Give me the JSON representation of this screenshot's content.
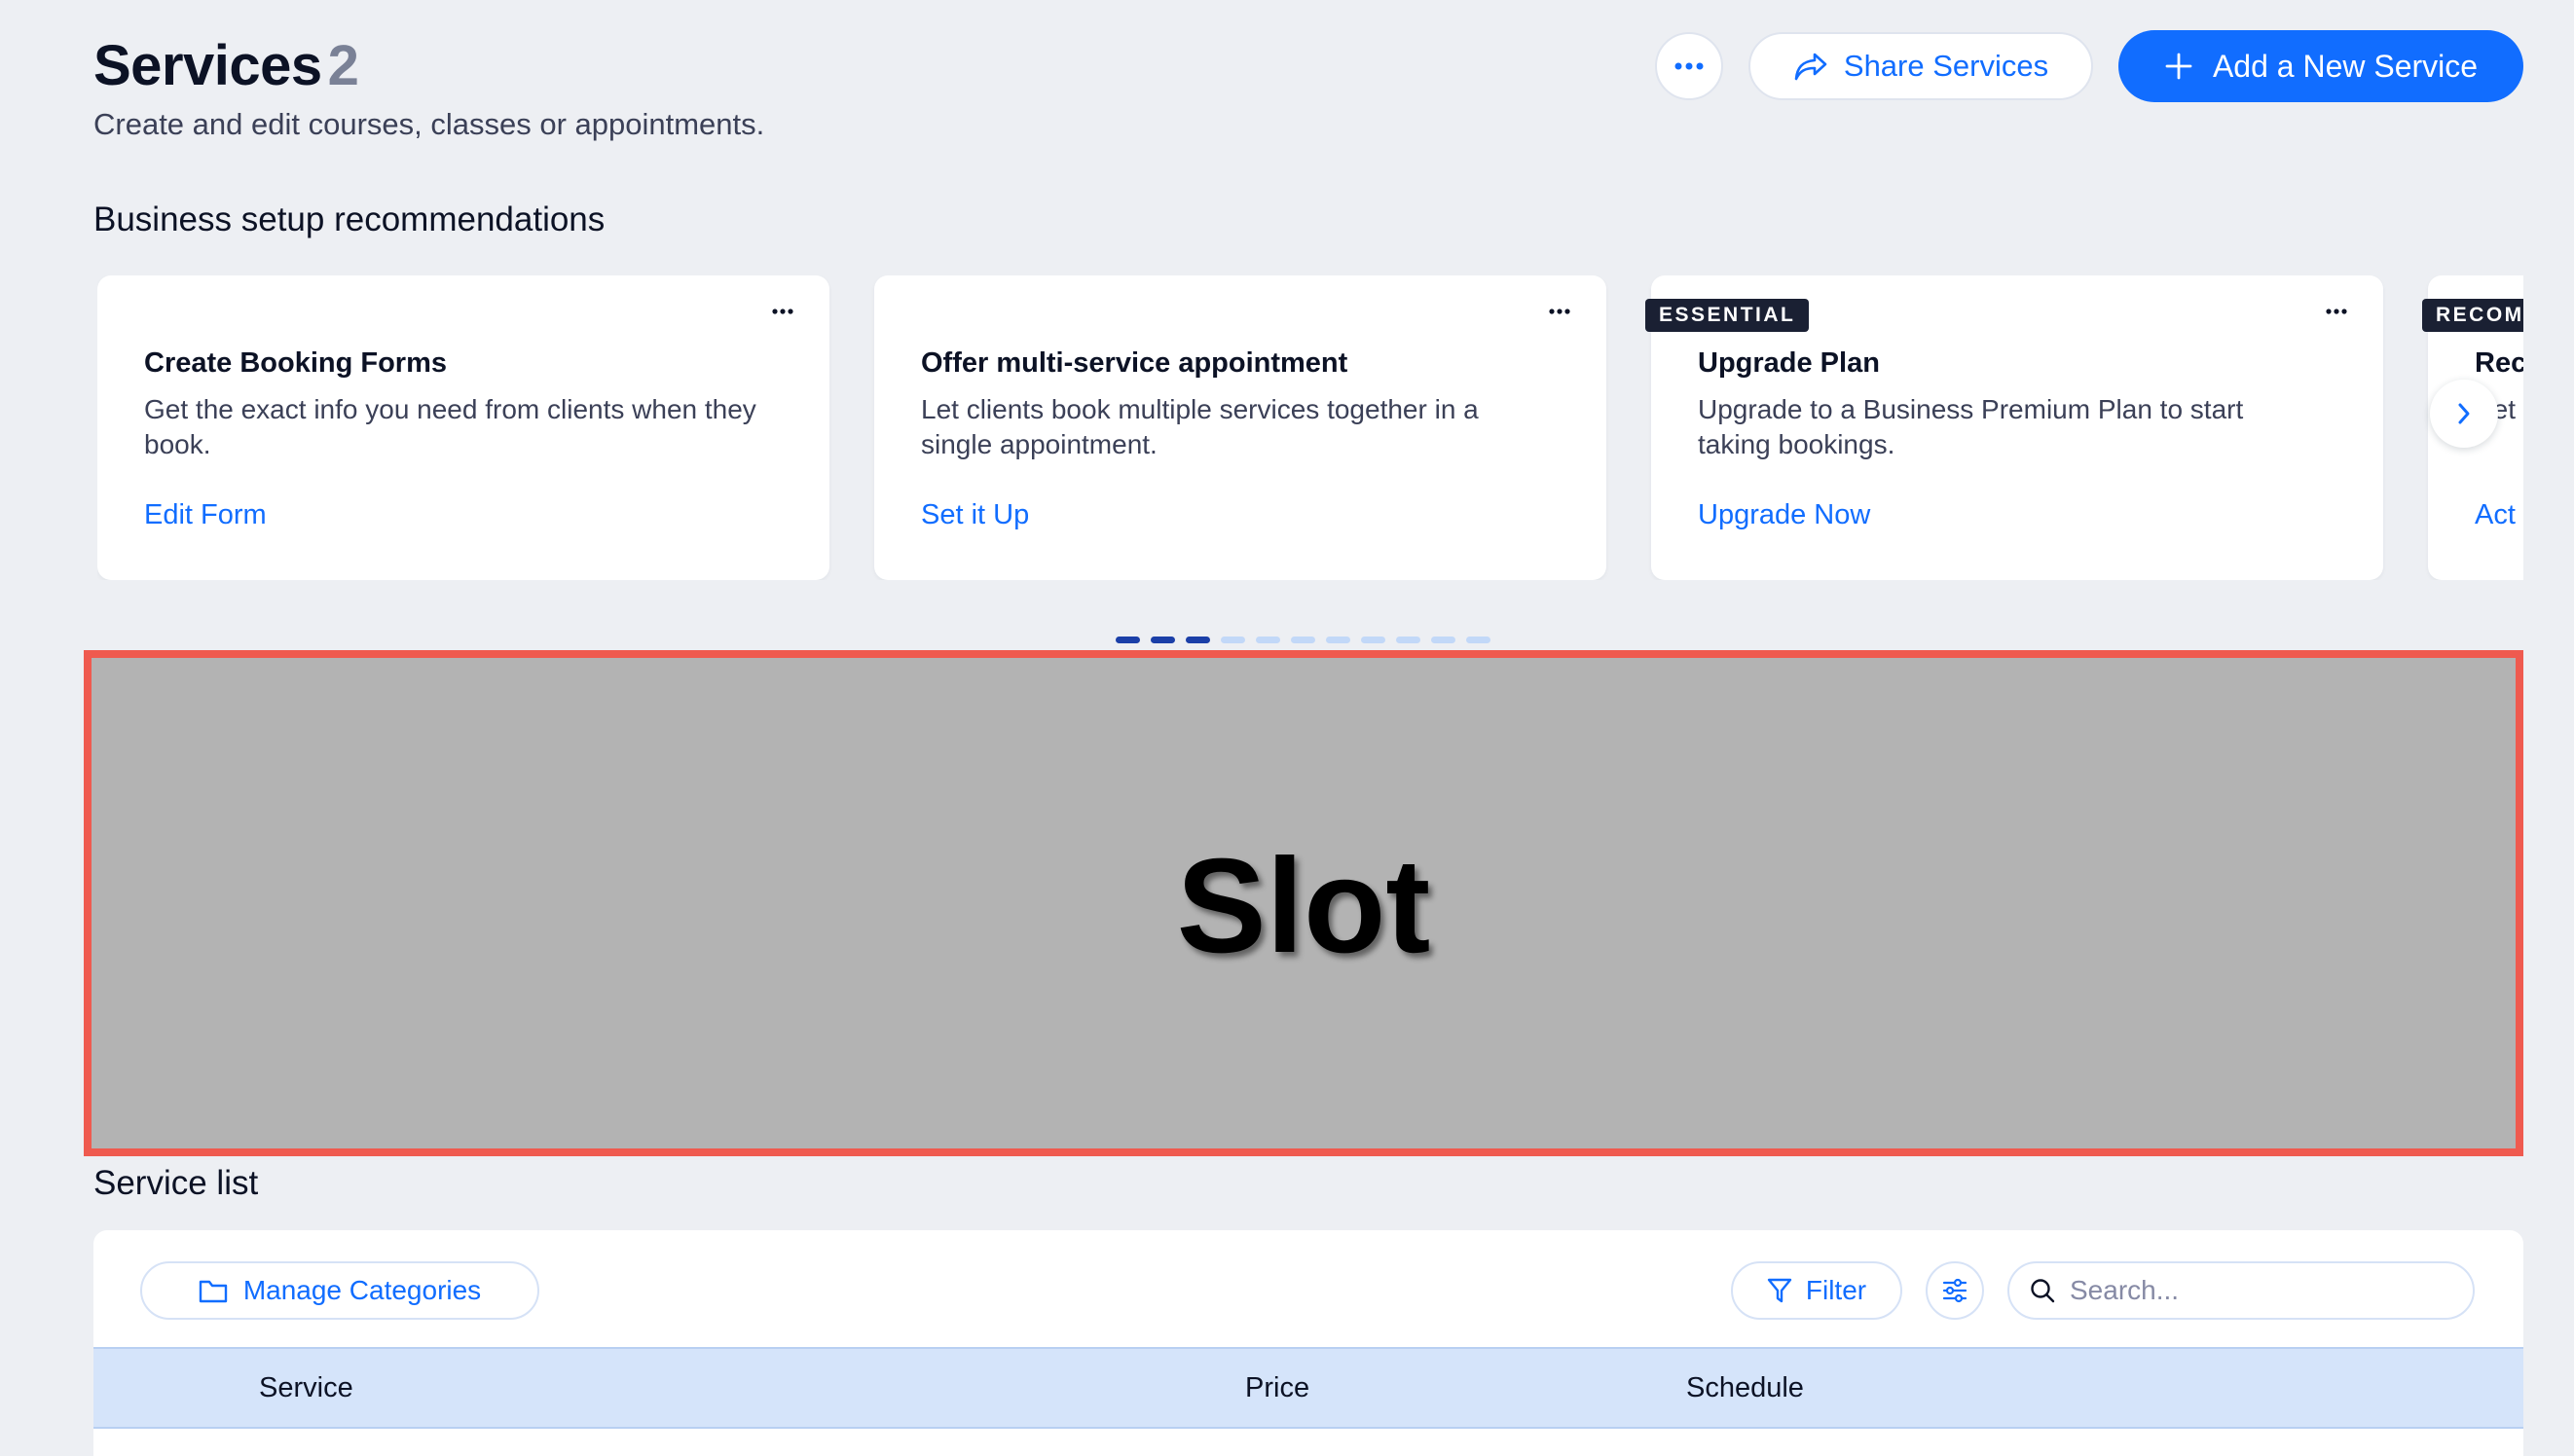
{
  "header": {
    "title": "Services",
    "count": "2",
    "subtitle": "Create and edit courses, classes or appointments.",
    "share_label": "Share Services",
    "add_label": "Add a New Service"
  },
  "recommendations": {
    "title": "Business setup recommendations",
    "cards": [
      {
        "badge": "",
        "title": "Create Booking Forms",
        "description": "Get the exact info you need from clients when they book.",
        "link": "Edit Form"
      },
      {
        "badge": "",
        "title": "Offer multi-service appointment",
        "description": "Let clients book multiple services together in a single appointment.",
        "link": "Set it Up"
      },
      {
        "badge": "ESSENTIAL",
        "title": "Upgrade Plan",
        "description": "Upgrade to a Business Premium Plan to start taking bookings.",
        "link": "Upgrade Now"
      },
      {
        "badge": "RECOM",
        "title": "Rec",
        "description": "Set unp",
        "link": "Act"
      }
    ],
    "pagination": {
      "total": 11,
      "active": [
        0,
        1,
        2
      ]
    }
  },
  "slot": {
    "label": "Slot"
  },
  "service_list": {
    "title": "Service list",
    "manage_categories": "Manage Categories",
    "filter": "Filter",
    "search_placeholder": "Search...",
    "columns": [
      "Service",
      "Price",
      "Schedule"
    ]
  },
  "colors": {
    "accent": "#116dff",
    "background": "#edeff3",
    "slot_border": "#ef5a4f",
    "slot_fill": "#b3b3b3",
    "table_header": "#d5e4fa"
  }
}
